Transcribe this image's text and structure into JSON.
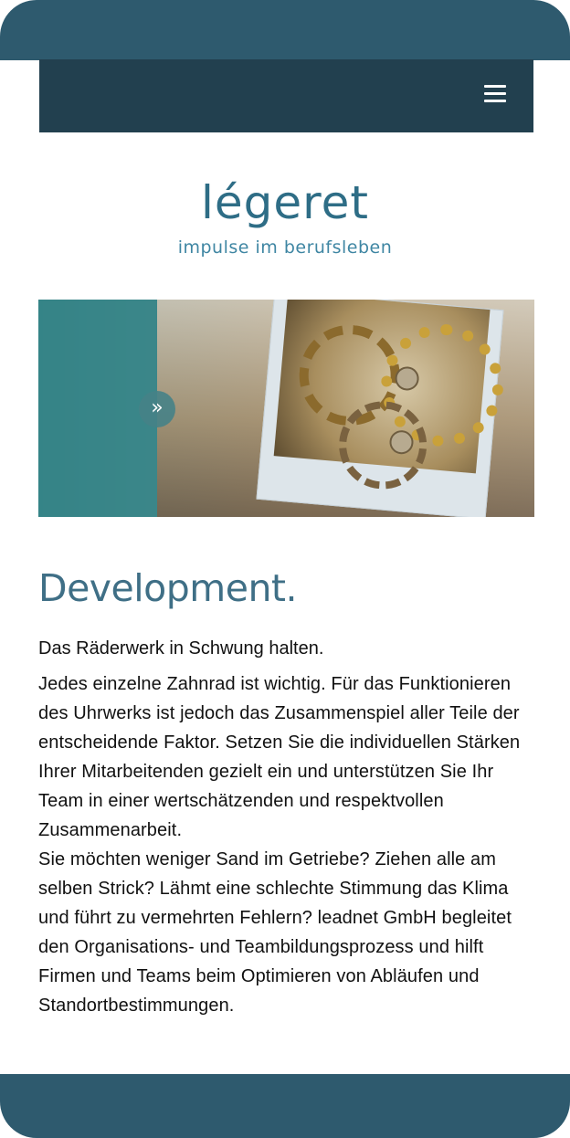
{
  "brand": {
    "name": "légeret",
    "tagline": "impulse im berufsleben"
  },
  "colors": {
    "frame": "#2e5a6e",
    "navbar": "#22404f",
    "logo": "#2e6d86",
    "title": "#3f6f86",
    "accent_teal": "#2f8286"
  },
  "nav": {
    "menu_icon": "hamburger-menu-icon"
  },
  "hero": {
    "next_icon": "double-chevron-right-icon",
    "next_glyph": "»"
  },
  "article": {
    "title": "Development.",
    "lead": "Das Räderwerk in Schwung halten.",
    "paragraph_1": "Jedes einzelne Zahnrad ist wichtig. Für das Funktionieren des Uhrwerks ist jedoch das Zusammenspiel aller Teile der entscheidende Faktor. Setzen Sie die individuellen Stärken Ihrer Mitarbeitenden gezielt ein und unterstützen Sie Ihr Team in einer wertschätzenden und respektvollen Zusammenarbeit.",
    "paragraph_2": "Sie möchten weniger Sand im Getriebe? Ziehen alle am selben Strick? Lähmt eine schlechte Stimmung das Klima und führt zu vermehrten Fehlern? leadnet GmbH begleitet den Organisations- und Teambildungsprozess und hilft Firmen und Teams beim Optimieren von Abläufen und Standortbestimmungen."
  }
}
